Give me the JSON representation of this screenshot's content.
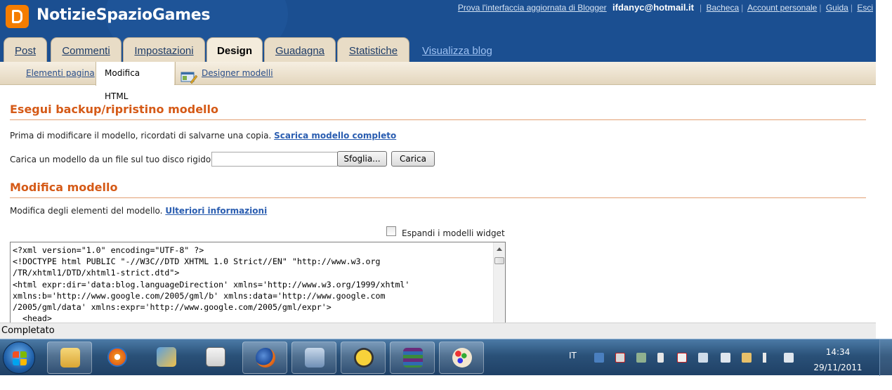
{
  "header": {
    "blog_title": "NotizieSpazioGames",
    "links": {
      "try_new": "Prova l'interfaccia aggiornata di Blogger",
      "user": "ifdanyc@hotmail.it",
      "dashboard": "Bacheca",
      "account": "Account personale",
      "help": "Guida",
      "signout": "Esci"
    }
  },
  "tabs": [
    {
      "label": "Post"
    },
    {
      "label": "Commenti"
    },
    {
      "label": "Impostazioni"
    },
    {
      "label": "Design"
    },
    {
      "label": "Guadagna"
    },
    {
      "label": "Statistiche"
    }
  ],
  "view_blog": "Visualizza blog",
  "subtabs": {
    "page_elements": "Elementi pagina",
    "edit_html": "Modifica HTML",
    "template_designer": "Designer modelli"
  },
  "backup": {
    "title": "Esegui backup/ripristino modello",
    "desc": "Prima di modificare il modello, ricordati di salvarne una copia.",
    "download_link": "Scarica modello completo",
    "upload_label": "Carica un modello da un file sul tuo disco rigido:",
    "browse_button": "Sfoglia...",
    "upload_button": "Carica"
  },
  "edit": {
    "title": "Modifica modello",
    "desc": "Modifica degli elementi del modello.",
    "more_info_link": "Ulteriori informazioni",
    "expand_widgets_label": "Espandi i modelli widget",
    "code": "<?xml version=\"1.0\" encoding=\"UTF-8\" ?>\n<!DOCTYPE html PUBLIC \"-//W3C//DTD XHTML 1.0 Strict//EN\" \"http://www.w3.org\n/TR/xhtml1/DTD/xhtml1-strict.dtd\">\n<html expr:dir='data:blog.languageDirection' xmlns='http://www.w3.org/1999/xhtml'\nxmlns:b='http://www.google.com/2005/gml/b' xmlns:data='http://www.google.com\n/2005/gml/data' xmlns:expr='http://www.google.com/2005/gml/expr'>\n  <head>"
  },
  "status": "Completato",
  "taskbar": {
    "apps": [
      "explorer-icon",
      "media-player-icon",
      "control-panel-icon",
      "signature-icon",
      "firefox-icon",
      "network-installer-icon",
      "java-icon",
      "winrar-icon",
      "paint-icon"
    ],
    "lang": "IT",
    "time": "14:34",
    "date": "29/11/2011"
  },
  "colors": {
    "header_bg": "#1b4f91",
    "accent_orange": "#d55a17",
    "link_blue": "#2a5db0",
    "tab_bg": "#e8dcc6"
  }
}
